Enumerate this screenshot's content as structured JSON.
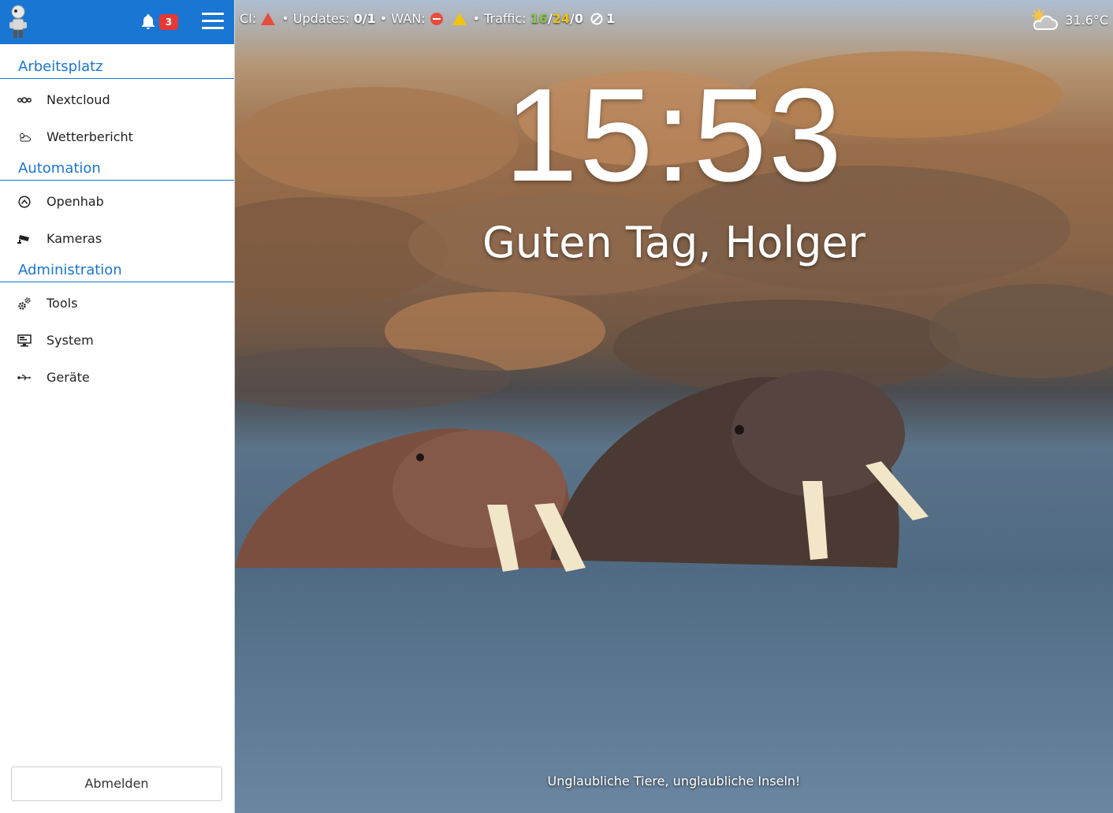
{
  "header": {
    "notification_count": "3"
  },
  "nav": {
    "sections": [
      {
        "title": "Arbeitsplatz",
        "items": [
          {
            "label": "Nextcloud",
            "icon": "nextcloud-icon"
          },
          {
            "label": "Wetterbericht",
            "icon": "weather-icon"
          }
        ]
      },
      {
        "title": "Automation",
        "items": [
          {
            "label": "Openhab",
            "icon": "openhab-icon"
          },
          {
            "label": "Kameras",
            "icon": "camera-icon"
          }
        ]
      },
      {
        "title": "Administration",
        "items": [
          {
            "label": "Tools",
            "icon": "gears-icon"
          },
          {
            "label": "System",
            "icon": "monitor-icon"
          },
          {
            "label": "Geräte",
            "icon": "usb-icon"
          }
        ]
      }
    ],
    "logout_label": "Abmelden"
  },
  "status": {
    "ci_label": "CI:",
    "updates_label": "• Updates:",
    "updates_value": "0/1",
    "wan_label": "• WAN:",
    "traffic_label": "• Traffic:",
    "traffic_green": "16",
    "slash1": "/",
    "traffic_yellow": "24",
    "traffic_rest": "/0",
    "blocked_value": "1"
  },
  "weather": {
    "temperature": "31.6°C"
  },
  "clock": "15:53",
  "greeting": "Guten Tag, Holger",
  "caption": "Unglaubliche Tiere, unglaubliche Inseln!",
  "colors": {
    "brand": "#1976d2",
    "badge": "#e53935",
    "traffic_green": "#8bc34a",
    "traffic_yellow": "#f1c40f",
    "alert_red": "#e74c3c"
  }
}
